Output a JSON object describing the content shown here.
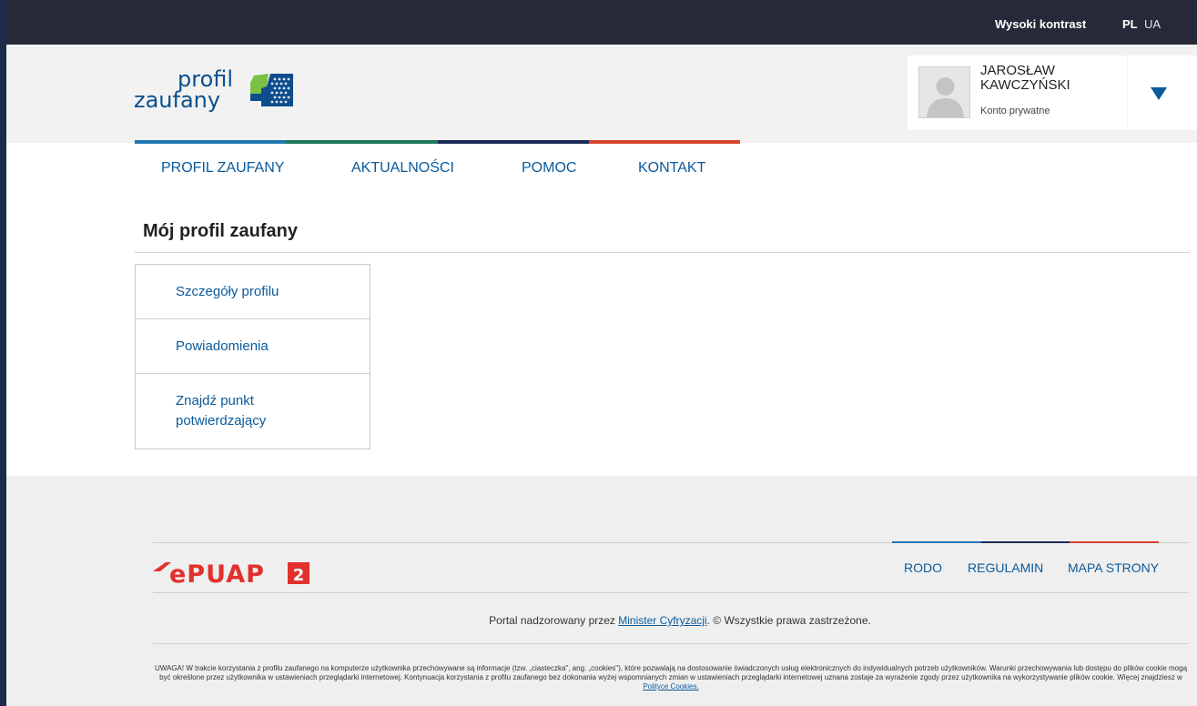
{
  "topbar": {
    "high_contrast": "Wysoki kontrast",
    "lang_pl": "PL",
    "lang_ua": "UA"
  },
  "header": {
    "logo": {
      "line1": "profil",
      "line2": "zaufany"
    },
    "user": {
      "name": "JAROSŁAW KAWCZYŃSKI",
      "account_type": "Konto prywatne"
    }
  },
  "nav": {
    "items": [
      {
        "label": "PROFIL ZAUFANY"
      },
      {
        "label": "AKTUALNOŚCI"
      },
      {
        "label": "POMOC"
      },
      {
        "label": "KONTAKT"
      }
    ],
    "stripe_colors": [
      "#1f78b4",
      "#1d7a5c",
      "#1d2b5a",
      "#d9432f"
    ]
  },
  "main": {
    "title": "Mój profil zaufany",
    "menu": [
      {
        "label": "Szczegóły profilu"
      },
      {
        "label": "Powiadomienia"
      },
      {
        "label": "Znajdź punkt potwierdzający"
      }
    ]
  },
  "footer": {
    "logo_text": "ePUAP",
    "logo_badge": "2",
    "links": [
      {
        "label": "RODO"
      },
      {
        "label": "REGULAMIN"
      },
      {
        "label": "MAPA STRONY"
      }
    ],
    "supervised_prefix": "Portal nadzorowany przez ",
    "supervised_link": "Minister Cyfryzacji",
    "supervised_suffix": ". © Wszystkie prawa zastrzeżone.",
    "notice_text": "UWAGA! W trakcie korzystania z profilu zaufanego na komputerze użytkownika przechowywane są informacje (tzw. „ciasteczka\", ang. „cookies\"), które pozwalają na dostosowanie świadczonych usług elektronicznych do indywidualnych potrzeb użytkowników. Warunki przechowywania lub dostępu do plików cookie mogą być określone przez użytkownika w ustawieniach przeglądarki internetowej. Kontynuacja korzystania z profilu zaufanego bez dokonania wyżej wspomnianych zmian w ustawieniach przeglądarki internetowej uznana zostaje za wyrażenie zgody przez użytkownika na wykorzystywanie plików cookie. Więcej znajdziesz w ",
    "notice_link": "Polityce Cookies."
  },
  "colors": {
    "brand_blue": "#0a5a9c",
    "topbar": "#262a38",
    "epuap_red": "#e2312d"
  }
}
